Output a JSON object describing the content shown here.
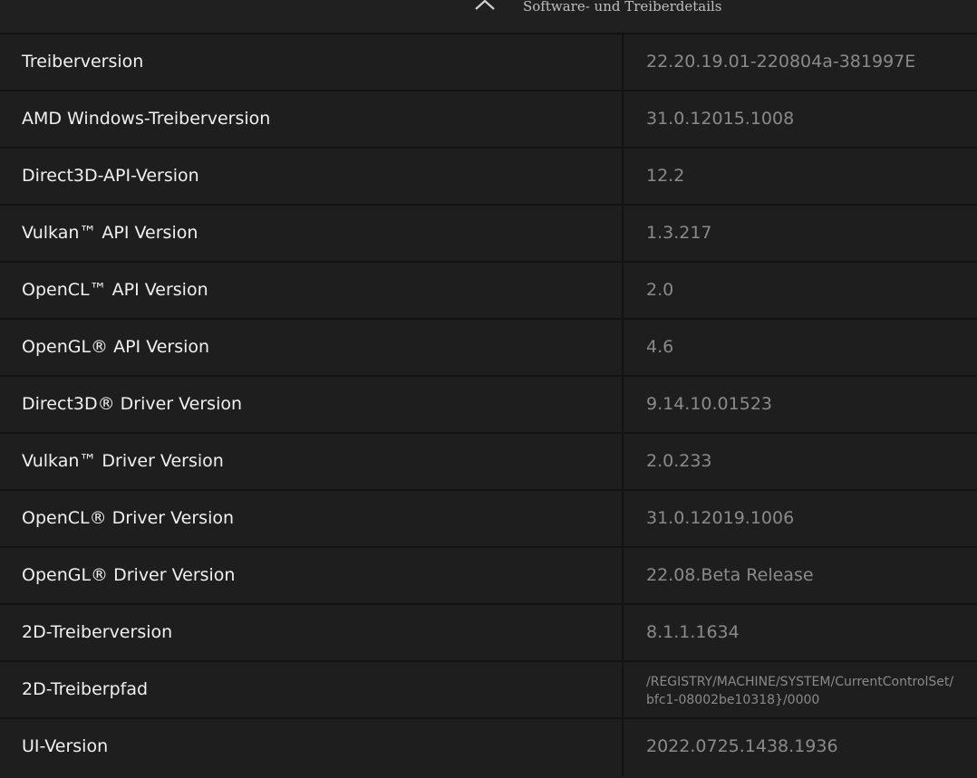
{
  "header": {
    "title": "Software- und Treiberdetails",
    "collapse_icon": "chevron-up-icon"
  },
  "rows": [
    {
      "label": "Treiberversion",
      "value": "22.20.19.01-220804a-381997E"
    },
    {
      "label": "AMD Windows-Treiberversion",
      "value": "31.0.12015.1008"
    },
    {
      "label": "Direct3D-API-Version",
      "value": "12.2"
    },
    {
      "label": "Vulkan™ API Version",
      "value": "1.3.217"
    },
    {
      "label": "OpenCL™ API Version",
      "value": "2.0"
    },
    {
      "label": "OpenGL® API Version",
      "value": "4.6"
    },
    {
      "label": "Direct3D® Driver Version",
      "value": "9.14.10.01523"
    },
    {
      "label": "Vulkan™ Driver Version",
      "value": "2.0.233"
    },
    {
      "label": "OpenCL® Driver Version",
      "value": "31.0.12019.1006"
    },
    {
      "label": "OpenGL® Driver Version",
      "value": "22.08.Beta Release"
    },
    {
      "label": "2D-Treiberversion",
      "value": "8.1.1.1634"
    },
    {
      "label": "2D-Treiberpfad",
      "value_line1": "/REGISTRY/MACHINE/SYSTEM/CurrentControlSet/",
      "value_line2": "bfc1-08002be10318}/0000"
    },
    {
      "label": "UI-Version",
      "value": "2022.0725.1438.1936"
    }
  ],
  "colors": {
    "background": "#1e1e1e",
    "label_text": "#f0f0f0",
    "value_text": "#8a8a8a",
    "divider": "#131313"
  }
}
